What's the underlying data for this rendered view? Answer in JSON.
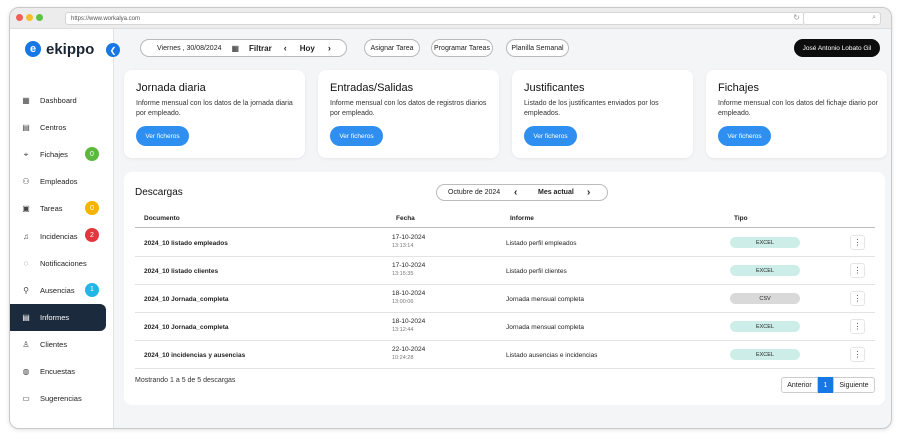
{
  "browser": {
    "url": "https://www.workalya.com"
  },
  "app": {
    "name": "ekippo",
    "logo_letter": "e",
    "user": "José Antonio Lobato Gil"
  },
  "sidebar": {
    "items": [
      {
        "label": "Dashboard",
        "icon": "grid-icon",
        "glyph": "▦"
      },
      {
        "label": "Centros",
        "icon": "building-icon",
        "glyph": "▤"
      },
      {
        "label": "Fichajes",
        "icon": "location-icon",
        "glyph": "⌖",
        "badge": "0",
        "badge_color": "#5cb83e"
      },
      {
        "label": "Empleados",
        "icon": "users-icon",
        "glyph": "⚇"
      },
      {
        "label": "Tareas",
        "icon": "calendar-icon",
        "glyph": "▣",
        "badge": "0",
        "badge_color": "#f5b400"
      },
      {
        "label": "Incidencias",
        "icon": "bell-icon",
        "glyph": "♫",
        "badge": "2",
        "badge_color": "#e0383e"
      },
      {
        "label": "Notificaciones",
        "icon": "notification-icon",
        "glyph": "◌"
      },
      {
        "label": "Ausencias",
        "icon": "user-absence-icon",
        "glyph": "⚲",
        "badge": "1",
        "badge_color": "#22b5e6"
      },
      {
        "label": "Informes",
        "icon": "document-icon",
        "glyph": "▤",
        "active": true
      },
      {
        "label": "Clientes",
        "icon": "person-icon",
        "glyph": "♙"
      },
      {
        "label": "Encuestas",
        "icon": "survey-icon",
        "glyph": "◍"
      },
      {
        "label": "Sugerencias",
        "icon": "inbox-icon",
        "glyph": "▭"
      }
    ]
  },
  "toolbar": {
    "date": "Viernes , 30/08/2024",
    "filter_label": "Filtrar",
    "today_label": "Hoy",
    "assign_task": "Asignar Tarea",
    "schedule_tasks": "Programar Tareas",
    "weekly_template": "Planilla Semanal"
  },
  "cards": [
    {
      "title": "Jornada diaria",
      "desc": "Informe mensual con los datos de la jornada diaria por empleado.",
      "button": "Ver ficheros"
    },
    {
      "title": "Entradas/Salidas",
      "desc": "Informe mensual con los datos de registros diarios por empleado.",
      "button": "Ver ficheros"
    },
    {
      "title": "Justificantes",
      "desc": "Listado de los justificantes enviados por los empleados.",
      "button": "Ver ficheros"
    },
    {
      "title": "Fichajes",
      "desc": "Informe mensual con los datos del fichaje diario por empleado.",
      "button": "Ver ficheros"
    }
  ],
  "downloads": {
    "title": "Descargas",
    "month": "Octubre de 2024",
    "current_month": "Mes actual",
    "columns": {
      "document": "Documento",
      "date": "Fecha",
      "report": "Informe",
      "type": "Tipo"
    },
    "rows": [
      {
        "document": "2024_10 listado empleados",
        "date": "17-10-2024",
        "time": "13:13:14",
        "report": "Listado perfil empleados",
        "type": "EXCEL"
      },
      {
        "document": "2024_10 listado clientes",
        "date": "17-10-2024",
        "time": "13:15:35",
        "report": "Listado perfil clientes",
        "type": "EXCEL"
      },
      {
        "document": "2024_10 Jornada_completa",
        "date": "18-10-2024",
        "time": "13:00:06",
        "report": "Jornada mensual completa",
        "type": "CSV"
      },
      {
        "document": "2024_10 Jornada_completa",
        "date": "18-10-2024",
        "time": "13:12:44",
        "report": "Jornada mensual completa",
        "type": "EXCEL"
      },
      {
        "document": "2024_10 incidencias y ausencias",
        "date": "22-10-2024",
        "time": "10:24:28",
        "report": "Listado ausencias e incidencias",
        "type": "EXCEL"
      }
    ],
    "footer": "Mostrando 1 a 5 de 5 descargas",
    "pager": {
      "prev": "Anterior",
      "page": "1",
      "next": "Siguiente"
    }
  },
  "colors": {
    "accent": "#1777e5",
    "button": "#2e8ff0",
    "active_nav": "#1c2a3d",
    "excel_tag": "#cdeee8",
    "csv_tag": "#d9d9d9"
  }
}
